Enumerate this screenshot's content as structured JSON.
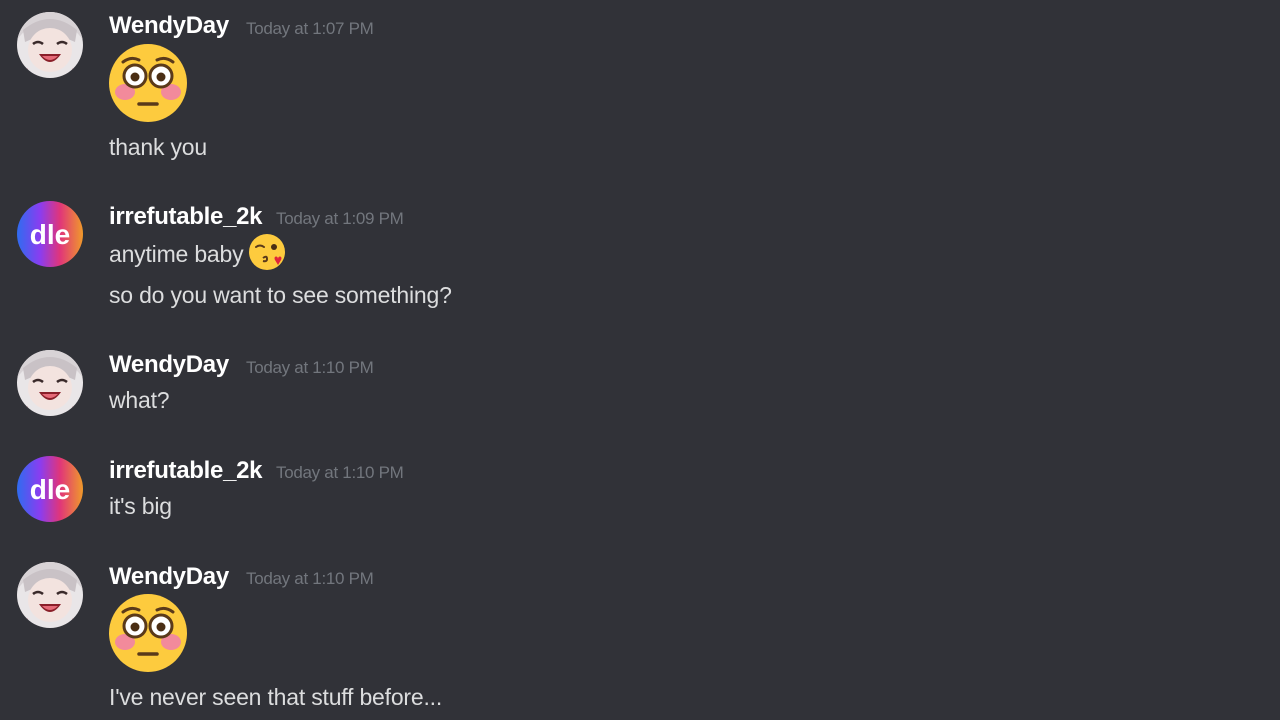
{
  "messages": [
    {
      "author": "WendyDay",
      "time": "Today at 1:07 PM",
      "emoji": "flushed-face",
      "text": "thank you"
    },
    {
      "author": "irrefutable_2k",
      "avatar_text": "dle",
      "time": "Today at 1:09 PM",
      "line1": "anytime baby",
      "line1_emoji": "kissing-face",
      "line2": "so do you want to see something?"
    },
    {
      "author": "WendyDay",
      "time": "Today at 1:10 PM",
      "text": "what?"
    },
    {
      "author": "irrefutable_2k",
      "avatar_text": "dle",
      "time": "Today at 1:10 PM",
      "text": "it's big"
    },
    {
      "author": "WendyDay",
      "time": "Today at 1:10 PM",
      "emoji": "flushed-face",
      "text": "I've never seen that stuff before..."
    }
  ],
  "colors": {
    "background": "#313238",
    "username": "#ffffff",
    "timestamp": "#72767d",
    "message_text": "#dcddde"
  }
}
